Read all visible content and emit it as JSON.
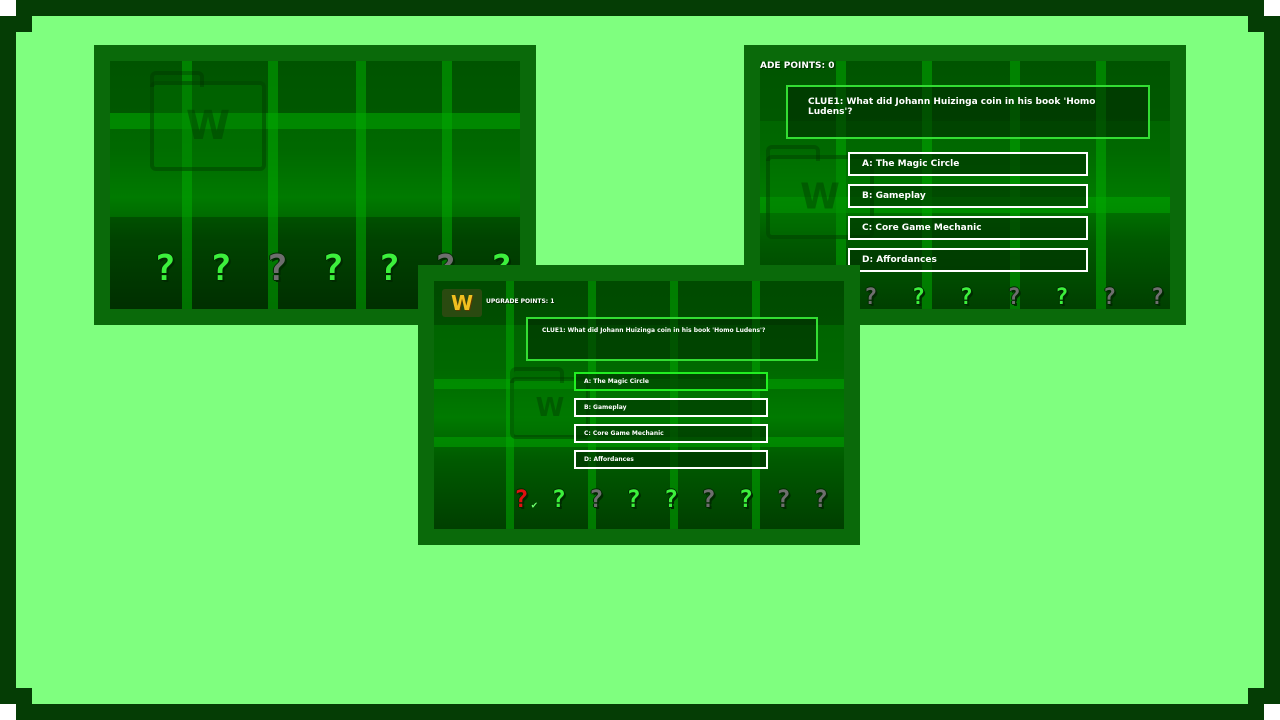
{
  "colors": {
    "border": "#053d05",
    "background": "#7fff7f",
    "panel_frame": "#0a6a0a",
    "clue_border": "#33dd33",
    "answer_border": "#ffffff",
    "selected_answer_border": "#22ee22",
    "clue_green": "#3cf03c",
    "clue_gray": "#6e6e6e",
    "clue_red": "#e01010"
  },
  "screen1": {
    "folder_glyph": "W",
    "clue_marks": [
      {
        "glyph": "?",
        "state": "green"
      },
      {
        "glyph": "?",
        "state": "green"
      },
      {
        "glyph": "?",
        "state": "gray"
      },
      {
        "glyph": "?",
        "state": "green"
      },
      {
        "glyph": "?",
        "state": "green"
      },
      {
        "glyph": "?",
        "state": "gray"
      },
      {
        "glyph": "?",
        "state": "green"
      }
    ]
  },
  "screen2": {
    "points_label": "ADE POINTS: 0",
    "clue_text": "CLUE1: What did Johann Huizinga coin in his book 'Homo Ludens'?",
    "answers": [
      "A: The Magic Circle",
      "B: Gameplay",
      "C: Core Game Mechanic",
      "D: Affordances"
    ],
    "folder_glyph": "W",
    "clue_marks": [
      {
        "glyph": "?",
        "state": "gray"
      },
      {
        "glyph": "?",
        "state": "green"
      },
      {
        "glyph": "?",
        "state": "green"
      },
      {
        "glyph": "?",
        "state": "gray"
      },
      {
        "glyph": "?",
        "state": "green"
      },
      {
        "glyph": "?",
        "state": "gray"
      },
      {
        "glyph": "?",
        "state": "gray"
      }
    ]
  },
  "screen3": {
    "logo_glyph": "W",
    "points_label": "UPGRADE POINTS: 1",
    "clue_text": "CLUE1: What did Johann Huizinga coin in his book 'Homo Ludens'?",
    "answers": [
      "A: The Magic Circle",
      "B: Gameplay",
      "C: Core Game Mechanic",
      "D: Affordances"
    ],
    "selected_answer_index": 0,
    "folder_glyph": "W",
    "check_glyph": "✔",
    "clue_marks": [
      {
        "glyph": "?",
        "state": "red",
        "checked": true
      },
      {
        "glyph": "?",
        "state": "green"
      },
      {
        "glyph": "?",
        "state": "gray"
      },
      {
        "glyph": "?",
        "state": "green"
      },
      {
        "glyph": "?",
        "state": "green"
      },
      {
        "glyph": "?",
        "state": "gray"
      },
      {
        "glyph": "?",
        "state": "green"
      },
      {
        "glyph": "?",
        "state": "gray"
      },
      {
        "glyph": "?",
        "state": "gray"
      }
    ]
  }
}
